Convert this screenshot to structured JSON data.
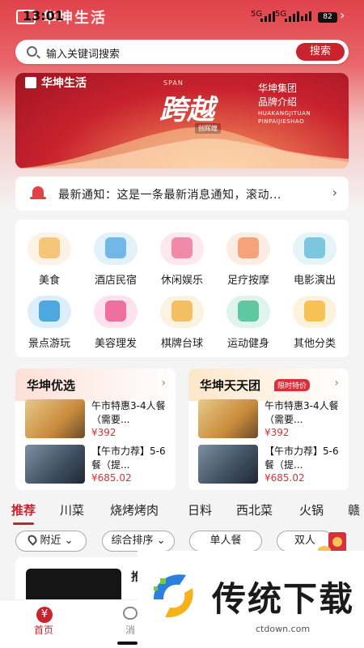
{
  "status_bar": {
    "brand_overlay": "华坤生活",
    "time": "13:01",
    "signal_1": "5G",
    "signal_2": "5G",
    "battery": "82"
  },
  "search": {
    "placeholder": "输入关键词搜索",
    "button_label": "搜索"
  },
  "banner": {
    "brand": "华坤生活",
    "span_label": "SPAN",
    "headline": "跨越",
    "sub_badge": "创辉煌",
    "line1": "华坤集团",
    "line2": "品牌介绍",
    "line3": "HUAKANGJITUAN",
    "line4": "PINPAIJIESHAO"
  },
  "notice": {
    "text": "最新通知：这是一条最新消息通知，滚动...",
    "arrow": "›"
  },
  "categories": [
    {
      "label": "美食",
      "icon": "food-icon",
      "color": "#f5c57a"
    },
    {
      "label": "酒店民宿",
      "icon": "hotel-icon",
      "color": "#6fb8e8"
    },
    {
      "label": "休闲娱乐",
      "icon": "cocktail-icon",
      "color": "#f08aa8"
    },
    {
      "label": "足疗按摩",
      "icon": "foot-icon",
      "color": "#f6a27a"
    },
    {
      "label": "电影演出",
      "icon": "film-icon",
      "color": "#7cc6e0"
    },
    {
      "label": "景点游玩",
      "icon": "palm-tree-icon",
      "color": "#4ea8e0"
    },
    {
      "label": "美容理发",
      "icon": "beauty-icon",
      "color": "#ef6fa0"
    },
    {
      "label": "棋牌台球",
      "icon": "cards-icon",
      "color": "#f2bf63"
    },
    {
      "label": "运动健身",
      "icon": "dumbbell-icon",
      "color": "#5fc7a2"
    },
    {
      "label": "其他分类",
      "icon": "grid-icon",
      "color": "#f6c253"
    }
  ],
  "sections": [
    {
      "title": "华坤优选",
      "tag": "",
      "items": [
        {
          "name": "午市特惠3-4人餐（需要...",
          "price": "¥392"
        },
        {
          "name": "【午市力荐】5-6餐（提...",
          "price": "¥685.02"
        }
      ]
    },
    {
      "title": "华坤天天团",
      "tag": "限时特价",
      "items": [
        {
          "name": "午市特惠3-4人餐（需要...",
          "price": "¥392"
        },
        {
          "name": "【午市力荐】5-6餐（提...",
          "price": "¥685.02"
        }
      ]
    }
  ],
  "tabs": [
    "推荐",
    "川菜",
    "烧烤烤肉",
    "日料",
    "西北菜",
    "火锅",
    "赣"
  ],
  "filters": {
    "nearby": "附近",
    "sort": "综合排序",
    "single": "单人餐",
    "double": "双人"
  },
  "feed": {
    "title_fragment": "推"
  },
  "watermark": {
    "title": "传统下载",
    "url": "ctdown.com"
  },
  "bottom_nav": {
    "home": "首页",
    "message": "消"
  },
  "colors": {
    "primary": "#c9232d",
    "accent": "#e0424a"
  }
}
